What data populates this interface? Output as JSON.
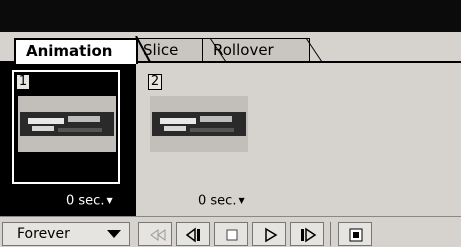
{
  "tabs": [
    {
      "label": "Animation",
      "active": true
    },
    {
      "label": "Slice",
      "active": false
    },
    {
      "label": "Rollover",
      "active": false
    }
  ],
  "frames": [
    {
      "number": "1",
      "delay": "0 sec.",
      "selected": true
    },
    {
      "number": "2",
      "delay": "0 sec.",
      "selected": false
    }
  ],
  "loop": {
    "value": "Forever"
  },
  "controls": [
    {
      "name": "first-frame-icon"
    },
    {
      "name": "previous-frame-icon"
    },
    {
      "name": "stop-icon"
    },
    {
      "name": "play-icon"
    },
    {
      "name": "next-frame-icon"
    },
    {
      "name": "tween-icon"
    }
  ],
  "colors": {
    "panel": "#d6d3ce",
    "selection": "#000000",
    "titlebar": "#0b0b0b"
  }
}
